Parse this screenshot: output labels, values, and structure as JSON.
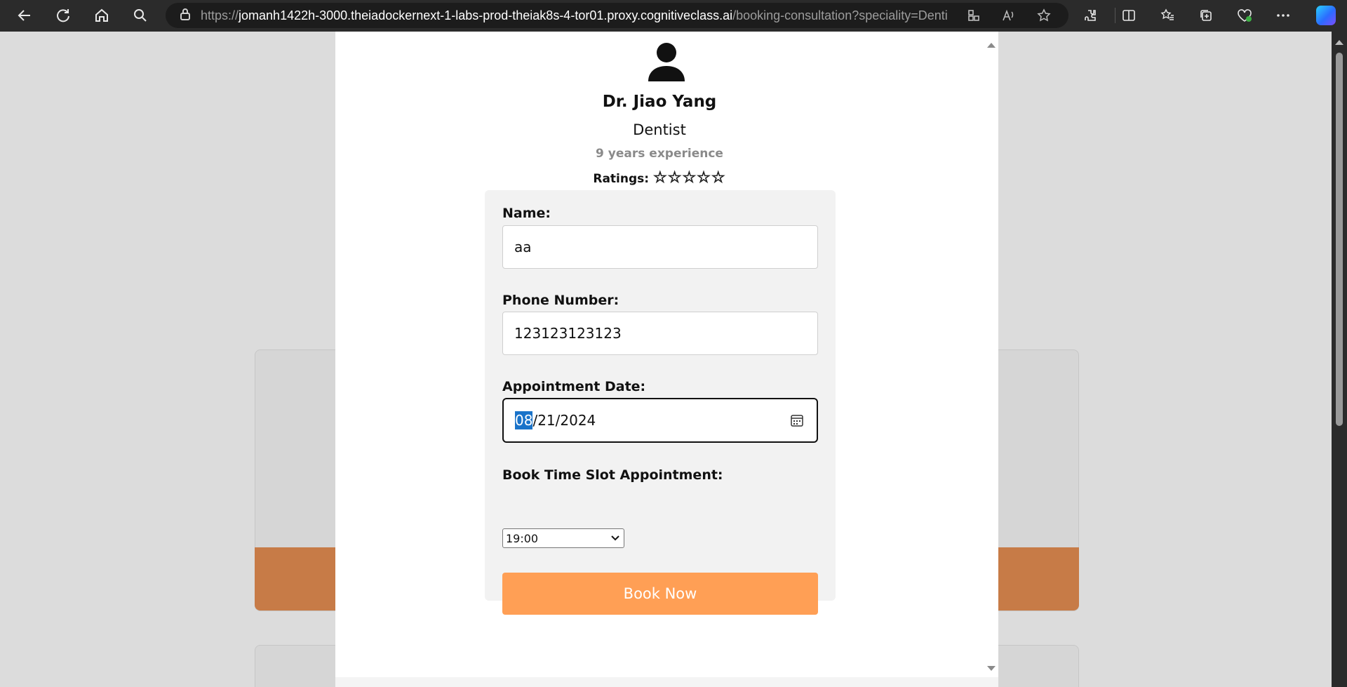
{
  "browser": {
    "url_prefix": "https://",
    "url_host": "jomanh1422h-3000.theiadockernext-1-labs-prod-theiak8s-4-tor01.proxy.cognitiveclass.ai",
    "url_path": "/booking-consultation?speciality=Dentist"
  },
  "doctor": {
    "name": "Dr. Jiao Yang",
    "speciality": "Dentist",
    "experience": "9 years experience",
    "ratings_label": "Ratings:",
    "stars": "☆☆☆☆☆",
    "rating_value": 5
  },
  "form": {
    "name_label": "Name:",
    "name_value": "aa",
    "phone_label": "Phone Number:",
    "phone_value": "123123123123",
    "date_label": "Appointment Date:",
    "date_month": "08",
    "date_rest": "/21/2024",
    "slot_label": "Book Time Slot Appointment:",
    "slot_value": "19:00",
    "book_button": "Book Now"
  },
  "colors": {
    "accent": "#ff9f55",
    "selection": "#1a73c9"
  }
}
